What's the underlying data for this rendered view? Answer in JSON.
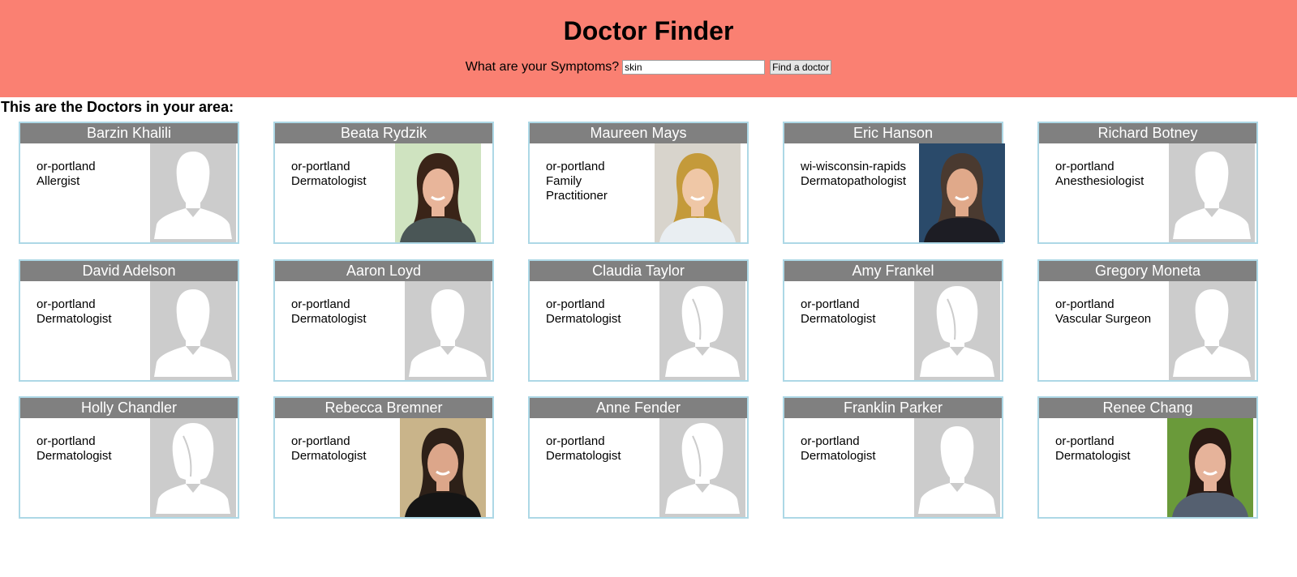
{
  "header": {
    "title": "Doctor Finder",
    "symptom_label": "What are your Symptoms?",
    "symptom_value": "skin",
    "find_button": "Find a doctor"
  },
  "results_heading": "This are the Doctors in your area:",
  "colors": {
    "header_bg": "#FA8072",
    "card_title_bg": "#808080",
    "card_border": "#ADD8E6",
    "placeholder_bg": "#CCCCCC"
  },
  "doctors": [
    {
      "name": "Barzin Khalili",
      "location": "or-portland",
      "specialty": "Allergist",
      "photo": "male-silhouette"
    },
    {
      "name": "Beata Rydzik",
      "location": "or-portland",
      "specialty": "Dermatologist",
      "photo": "female-photo-brunette"
    },
    {
      "name": "Maureen Mays",
      "location": "or-portland",
      "specialty": "Family Practitioner",
      "photo": "female-photo-blonde"
    },
    {
      "name": "Eric Hanson",
      "location": "wi-wisconsin-rapids",
      "specialty": "Dermatopathologist",
      "photo": "male-photo-suit"
    },
    {
      "name": "Richard Botney",
      "location": "or-portland",
      "specialty": "Anesthesiologist",
      "photo": "male-silhouette"
    },
    {
      "name": "David Adelson",
      "location": "or-portland",
      "specialty": "Dermatologist",
      "photo": "male-silhouette"
    },
    {
      "name": "Aaron Loyd",
      "location": "or-portland",
      "specialty": "Dermatologist",
      "photo": "male-silhouette"
    },
    {
      "name": "Claudia Taylor",
      "location": "or-portland",
      "specialty": "Dermatologist",
      "photo": "female-silhouette"
    },
    {
      "name": "Amy Frankel",
      "location": "or-portland",
      "specialty": "Dermatologist",
      "photo": "female-silhouette"
    },
    {
      "name": "Gregory Moneta",
      "location": "or-portland",
      "specialty": "Vascular Surgeon",
      "photo": "male-silhouette"
    },
    {
      "name": "Holly Chandler",
      "location": "or-portland",
      "specialty": "Dermatologist",
      "photo": "female-silhouette"
    },
    {
      "name": "Rebecca Bremner",
      "location": "or-portland",
      "specialty": "Dermatologist",
      "photo": "female-photo-short-hair"
    },
    {
      "name": "Anne Fender",
      "location": "or-portland",
      "specialty": "Dermatologist",
      "photo": "female-silhouette"
    },
    {
      "name": "Franklin Parker",
      "location": "or-portland",
      "specialty": "Dermatologist",
      "photo": "male-silhouette"
    },
    {
      "name": "Renee Chang",
      "location": "or-portland",
      "specialty": "Dermatologist",
      "photo": "female-photo-outdoor"
    }
  ]
}
